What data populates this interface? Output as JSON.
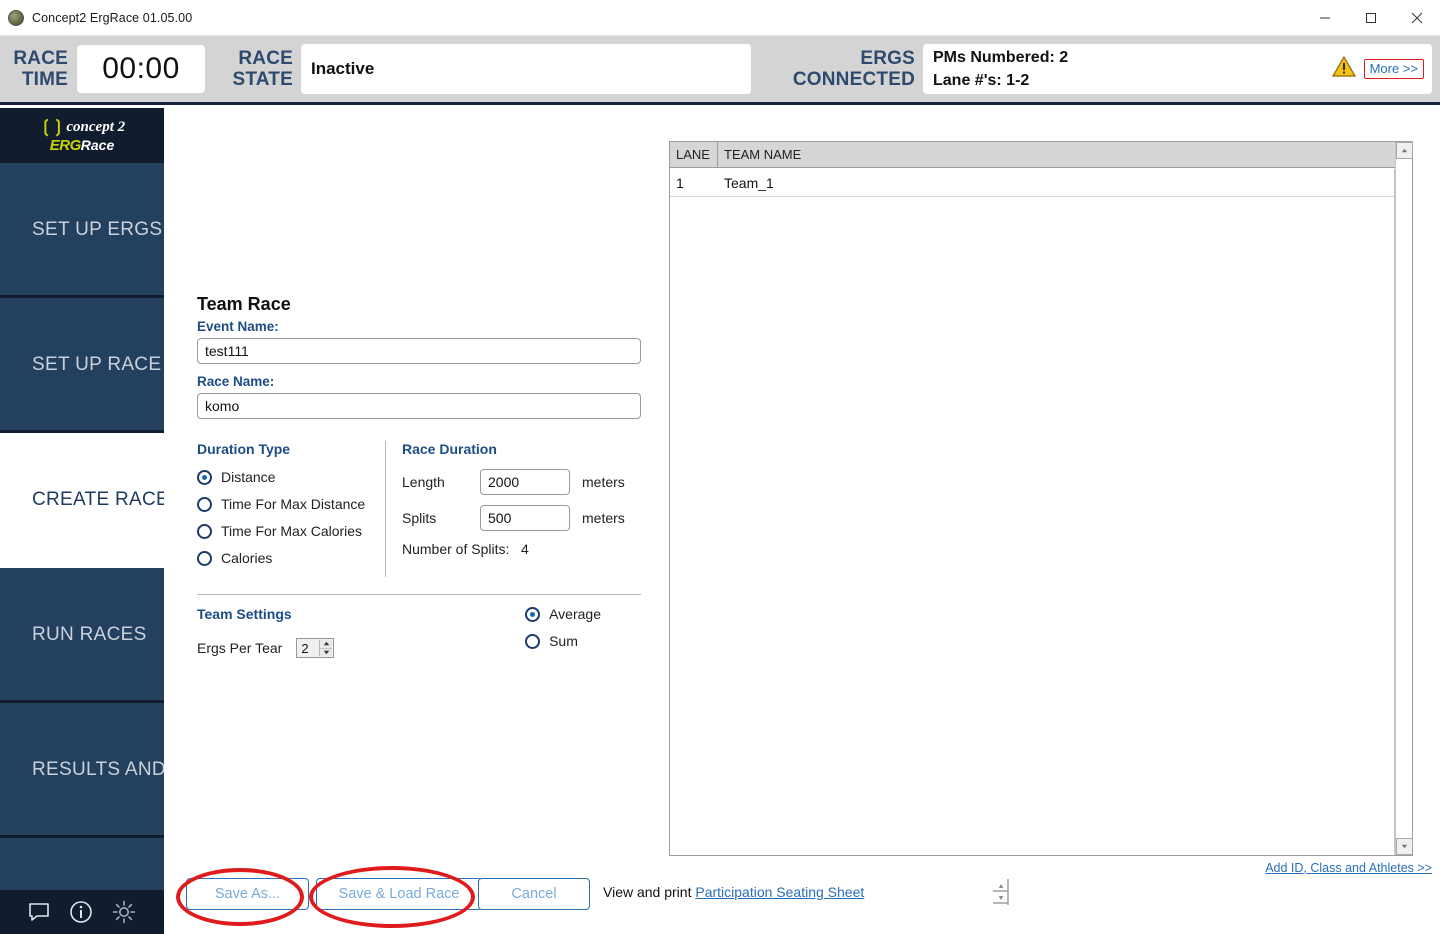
{
  "window": {
    "title": "Concept2 ErgRace 01.05.00",
    "icon": "app-icon",
    "minimize": "–",
    "maximize": "□",
    "close": "✕"
  },
  "status": {
    "race_time_label_line1": "RACE",
    "race_time_label_line2": "TIME",
    "race_time_value": "00:00",
    "race_state_label_line1": "RACE",
    "race_state_label_line2": "STATE",
    "race_state_value": "Inactive",
    "ergs_label_line1": "ERGS",
    "ergs_label_line2": "CONNECTED",
    "pms_numbered": "PMs Numbered: 2",
    "lane_numbers": "Lane #'s: 1-2",
    "warning_icon": "warning-triangle-icon",
    "more_link": "More >>",
    "more_link_outline_color": "#e01b1b",
    "warning_color": "#f2c018"
  },
  "sidebar": {
    "logo": {
      "mark": "((",
      "brand": "concept 2",
      "product_part1": "ERG",
      "product_part2": "Race"
    },
    "items": [
      {
        "label": "SET UP ERGS",
        "active": false
      },
      {
        "label": "SET UP RACE DISPLAY",
        "active": false
      },
      {
        "label": "CREATE RACE",
        "active": true
      },
      {
        "label": "RUN RACES",
        "active": false
      },
      {
        "label": "RESULTS AND REPORTS",
        "active": false
      }
    ],
    "bottom_icons": [
      {
        "name": "chat-icon"
      },
      {
        "name": "info-icon"
      },
      {
        "name": "gear-icon"
      }
    ],
    "bg_color": "#24405f",
    "active_text_color": "#1d3a5f"
  },
  "form": {
    "title": "Team Race",
    "event_name_label": "Event Name:",
    "event_name_value": "test111",
    "event_name_placeholder": "",
    "race_name_label": "Race Name:",
    "race_name_value": "komo",
    "race_name_placeholder": "",
    "duration_type": {
      "heading": "Duration Type",
      "options": [
        {
          "label": "Distance",
          "selected": true
        },
        {
          "label": "Time For Max Distance",
          "selected": false
        },
        {
          "label": "Time For Max Calories",
          "selected": false
        },
        {
          "label": "Calories",
          "selected": false
        }
      ]
    },
    "race_duration": {
      "heading": "Race Duration",
      "length_label": "Length",
      "length_value": "2000",
      "length_unit": "meters",
      "splits_label": "Splits",
      "splits_value": "500",
      "splits_unit": "meters",
      "number_of_splits_label": "Number of Splits:",
      "number_of_splits_value": "4"
    },
    "team_settings": {
      "heading": "Team Settings",
      "ergs_per_team_label": "Ergs Per Tear",
      "ergs_per_team_value": "2",
      "aggregate_options": [
        {
          "label": "Average",
          "selected": true
        },
        {
          "label": "Sum",
          "selected": false
        }
      ]
    }
  },
  "table": {
    "columns": [
      "LANE",
      "TEAM NAME"
    ],
    "rows": [
      {
        "lane": "1",
        "team_name": "Team_1"
      }
    ],
    "scroll_up": "▲",
    "scroll_down": "▼"
  },
  "links": {
    "add_athletes": "Add ID, Class and Athletes >>",
    "print_prefix": "View and print",
    "print_link": "Participation Seating Sheet"
  },
  "footer": {
    "save_as": "Save As...",
    "save_and_load": "Save & Load Race",
    "cancel": "Cancel"
  },
  "annotations": {
    "color": "#e01b1b",
    "shapes": [
      "ellipse-around-save-as",
      "ellipse-around-save-and-load-race"
    ]
  }
}
